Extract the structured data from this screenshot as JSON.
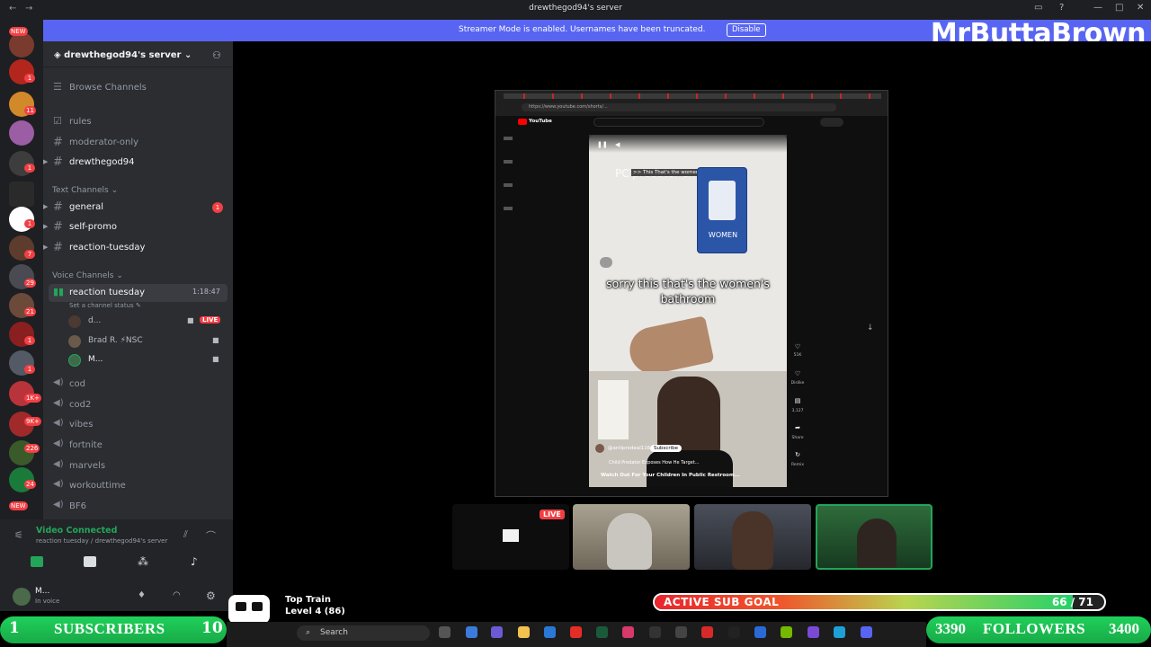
{
  "window": {
    "title": "drewthegod94's server",
    "back_icon": "←",
    "forward_icon": "→"
  },
  "banner": {
    "message": "Streamer Mode is enabled. Usernames have been truncated.",
    "button": "Disable"
  },
  "streamer_name": "MrButtaBrown",
  "rail": {
    "badges": [
      "NEW",
      "1",
      "11",
      "1",
      "1",
      "7",
      "29",
      "21",
      "1",
      "1",
      "1K+",
      "9K+",
      "226",
      "24",
      "NEW"
    ]
  },
  "server": {
    "name": "drewthegod94's server",
    "browse": "Browse Channels",
    "top_channels": [
      "rules",
      "moderator-only",
      "drewthegod94"
    ],
    "text_category": "Text Channels",
    "text_channels": [
      {
        "name": "general",
        "badge": "1"
      },
      {
        "name": "self-promo",
        "badge": ""
      },
      {
        "name": "reaction-tuesday",
        "badge": ""
      }
    ],
    "voice_category": "Voice Channels",
    "active_voice": {
      "name": "reaction tuesday",
      "time": "1:18:47",
      "status": "Set a channel status",
      "users": [
        {
          "name": "d...",
          "live": "LIVE"
        },
        {
          "name": "Brad R. ⚡NSC",
          "live": ""
        },
        {
          "name": "M...",
          "live": ""
        }
      ]
    },
    "voice_channels": [
      "cod",
      "cod2",
      "vibes",
      "fortnite",
      "marvels",
      "workouttime",
      "BF6"
    ]
  },
  "voice_panel": {
    "status": "Video Connected",
    "location": "reaction tuesday / drewthegod94's server"
  },
  "user_panel": {
    "name": "M...",
    "status": "In voice"
  },
  "youtube": {
    "logo": "YouTube",
    "url": "https://www.youtube.com/shorts/...",
    "caption": "sorry this that's the women's bathroom",
    "overlay_text": ">> This That's the women's bathroom.",
    "top_text": "PC predator on kids",
    "sign_text": "WOMEN",
    "channel": "@antiprodeal116",
    "subscribe": "Subscribe",
    "description": "Child Predator Exposes How He Target...",
    "title": "Watch Out For Your Children In Public Restroom...",
    "side_labels": [
      "51K",
      "Dislike",
      "3,127",
      "Share",
      "Remix"
    ]
  },
  "live_tag": "LIVE",
  "top_train": {
    "title": "Top Train",
    "level": "Level 4 (86)"
  },
  "sub_goal": {
    "label": "ACTIVE SUB GOAL",
    "current": 66,
    "target": 71,
    "text": "66 / 71"
  },
  "subscribers": {
    "left": "1",
    "label": "SUBSCRIBERS",
    "right": "10"
  },
  "followers": {
    "left": "3390",
    "label": "FOLLOWERS",
    "right": "3400"
  },
  "taskbar": {
    "search": "Search"
  }
}
